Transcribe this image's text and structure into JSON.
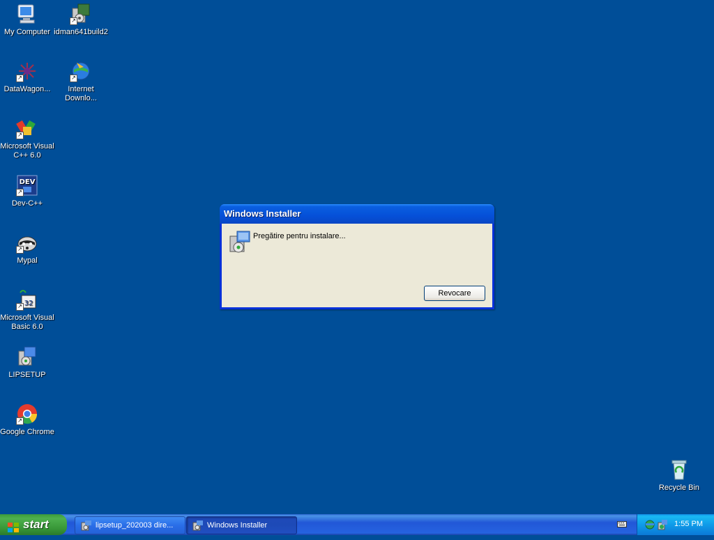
{
  "desktop": {
    "icons": [
      {
        "label": "My Computer"
      },
      {
        "label": "idman641build2"
      },
      {
        "label": "DataWagon..."
      },
      {
        "label": "Internet\nDownlo..."
      },
      {
        "label": "Microsoft Visual\nC++ 6.0"
      },
      {
        "label": "Dev-C++"
      },
      {
        "label": "Mypal"
      },
      {
        "label": "Microsoft Visual\nBasic 6.0"
      },
      {
        "label": "LIPSETUP"
      },
      {
        "label": "Google Chrome"
      },
      {
        "label": "Recycle Bin"
      }
    ]
  },
  "dialog": {
    "title": "Windows Installer",
    "message": "Pregătire pentru instalare...",
    "cancel_label": "Revocare"
  },
  "taskbar": {
    "start_label": "start",
    "tasks": [
      {
        "label": "lipsetup_202003 dire..."
      },
      {
        "label": "Windows Installer"
      }
    ],
    "clock": "1:55 PM"
  }
}
